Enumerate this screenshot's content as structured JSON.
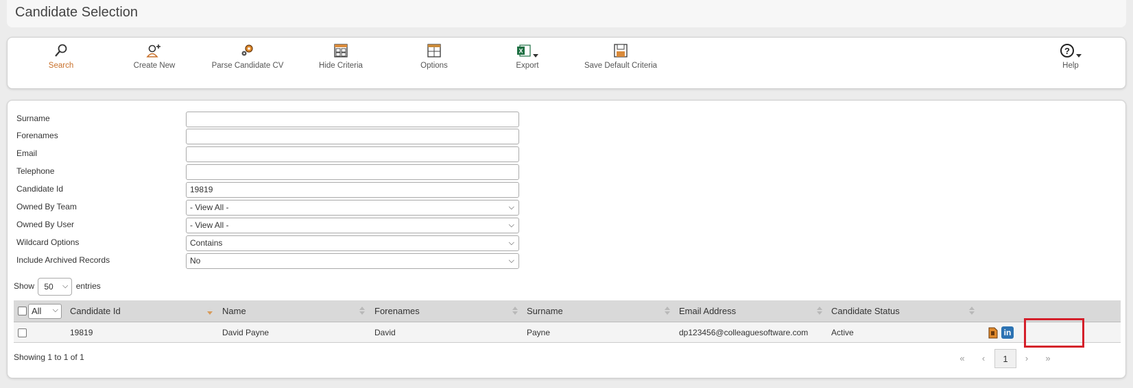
{
  "page": {
    "title": "Candidate Selection"
  },
  "toolbar": {
    "buttons": [
      {
        "label": "Search",
        "icon": "search-icon"
      },
      {
        "label": "Create New",
        "icon": "add-user-icon"
      },
      {
        "label": "Parse Candidate CV",
        "icon": "gears-icon"
      },
      {
        "label": "Hide Criteria",
        "icon": "checklist-icon"
      },
      {
        "label": "Options",
        "icon": "options-grid-icon"
      },
      {
        "label": "Export",
        "icon": "excel-icon"
      },
      {
        "label": "Save Default Criteria",
        "icon": "save-icon"
      },
      {
        "label": "Help",
        "icon": "help-icon"
      }
    ],
    "accent": "#c8702a"
  },
  "criteria": {
    "surname": {
      "label": "Surname",
      "value": ""
    },
    "forenames": {
      "label": "Forenames",
      "value": ""
    },
    "email": {
      "label": "Email",
      "value": ""
    },
    "telephone": {
      "label": "Telephone",
      "value": ""
    },
    "candidate_id": {
      "label": "Candidate Id",
      "value": "19819"
    },
    "owned_by_team": {
      "label": "Owned By Team",
      "value": "- View All -"
    },
    "owned_by_user": {
      "label": "Owned By User",
      "value": "- View All -"
    },
    "wildcard": {
      "label": "Wildcard Options",
      "value": "Contains"
    },
    "archived": {
      "label": "Include Archived Records",
      "value": "No"
    }
  },
  "table": {
    "show_label": "Show",
    "entries_label": "entries",
    "page_size": "50",
    "select_all": "All",
    "headers": [
      "Candidate Id",
      "Name",
      "Forenames",
      "Surname",
      "Email Address",
      "Candidate Status"
    ],
    "rows": [
      {
        "candidate_id": "19819",
        "name": "David Payne",
        "forenames": "David",
        "surname": "Payne",
        "email": "dp123456@colleaguesoftware.com",
        "status": "Active"
      }
    ],
    "info": "Showing 1 to 1 of 1",
    "pagination": {
      "first": "«",
      "prev": "‹",
      "current": "1",
      "next": "›",
      "last": "»"
    }
  }
}
